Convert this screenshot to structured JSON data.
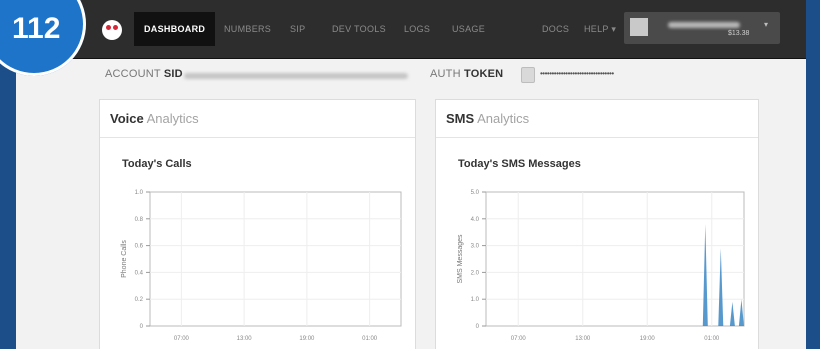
{
  "badge": {
    "number": "112"
  },
  "navbar": {
    "items": [
      {
        "label": "DASHBOARD",
        "active": true
      },
      {
        "label": "NUMBERS"
      },
      {
        "label": "SIP"
      },
      {
        "label": "DEV TOOLS"
      },
      {
        "label": "LOGS"
      },
      {
        "label": "USAGE"
      },
      {
        "label": "DOCS"
      },
      {
        "label": "HELP ▾"
      }
    ],
    "account": {
      "balance": "$13.38",
      "caret": "▾"
    }
  },
  "credentials": {
    "account_sid_prefix": "ACCOUNT ",
    "account_sid_bold": "SID",
    "auth_token_prefix": "AUTH ",
    "auth_token_bold": "TOKEN",
    "auth_token_masked": "••••••••••••••••••••••••••••••••"
  },
  "voice": {
    "panel_title_bold": "Voice",
    "panel_title_rest": " Analytics",
    "chart_title": "Today's Calls"
  },
  "sms": {
    "panel_title_bold": "SMS",
    "panel_title_rest": " Analytics",
    "chart_title": "Today's SMS Messages"
  },
  "chart_data": [
    {
      "type": "line",
      "title": "Today's Calls",
      "ylabel": "Phone Calls",
      "xlabel": "",
      "ylim": [
        0,
        1.0
      ],
      "y_ticks": [
        "0",
        "0.2",
        "0.4",
        "0.6",
        "0.8",
        "1.0"
      ],
      "x_ticks": [
        "07:00",
        "13:00",
        "19:00",
        "01:00"
      ],
      "grid": true,
      "series": [
        {
          "values": []
        }
      ]
    },
    {
      "type": "area",
      "title": "Today's SMS Messages",
      "ylabel": "SMS Messages",
      "xlabel": "",
      "ylim": [
        0,
        5.0
      ],
      "y_ticks": [
        "0",
        "1.0",
        "2.0",
        "3.0",
        "4.0",
        "5.0"
      ],
      "x_ticks": [
        "07:00",
        "13:00",
        "19:00",
        "01:00"
      ],
      "grid": true,
      "color": "#3b87c4",
      "series": [
        {
          "spikes": [
            {
              "x_frac": 0.85,
              "value": 3.8
            },
            {
              "x_frac": 0.91,
              "value": 2.9
            },
            {
              "x_frac": 0.955,
              "value": 0.9
            },
            {
              "x_frac": 0.99,
              "value": 1.0
            }
          ]
        }
      ]
    }
  ]
}
